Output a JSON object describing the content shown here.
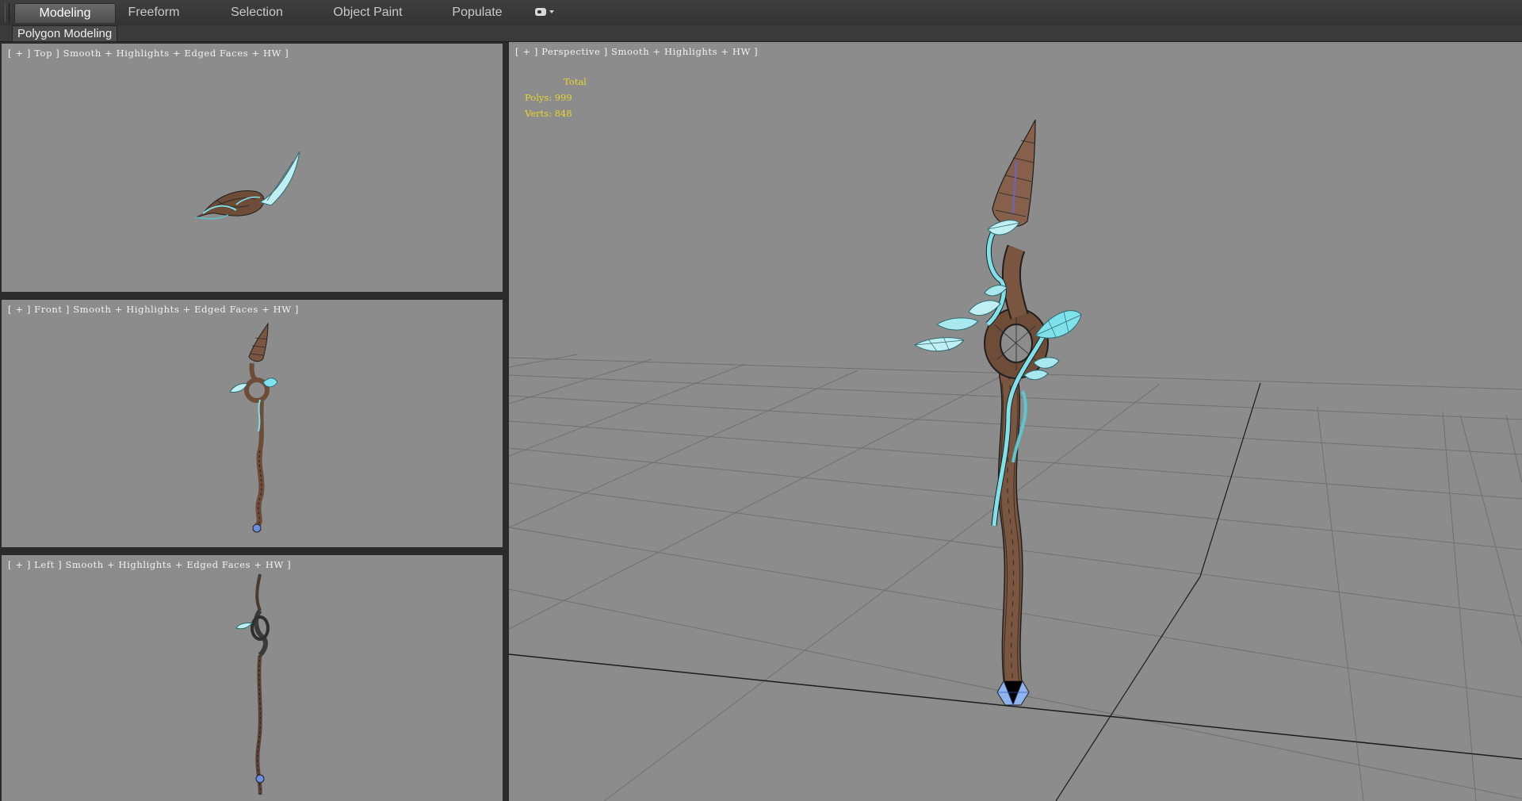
{
  "ribbon": {
    "tabs": [
      {
        "label": "Modeling",
        "active": true
      },
      {
        "label": "Freeform",
        "active": false
      },
      {
        "label": "Selection",
        "active": false
      },
      {
        "label": "Object Paint",
        "active": false
      },
      {
        "label": "Populate",
        "active": false
      }
    ],
    "dropdown_icon": "toggle-icon",
    "panel_label": "Polygon Modeling"
  },
  "viewports": {
    "top": {
      "label": "[ + ] Top ] Smooth + Highlights + Edged Faces + HW ]"
    },
    "front": {
      "label": "[ + ] Front ] Smooth + Highlights + Edged Faces + HW ]"
    },
    "left": {
      "label": "[ + ] Left ] Smooth + Highlights + Edged Faces + HW ]"
    },
    "perspective": {
      "label": "[ + ] Perspective ] Smooth + Highlights + HW ]",
      "stats": {
        "title": "Total",
        "polys": "Polys: 999",
        "verts": "Verts: 848"
      }
    }
  },
  "colors": {
    "viewport_bg": "#8c8c8c",
    "staff_wood": "#7a5640",
    "staff_crystal": "#7fe2ea",
    "stats_text": "#e8d62a"
  }
}
